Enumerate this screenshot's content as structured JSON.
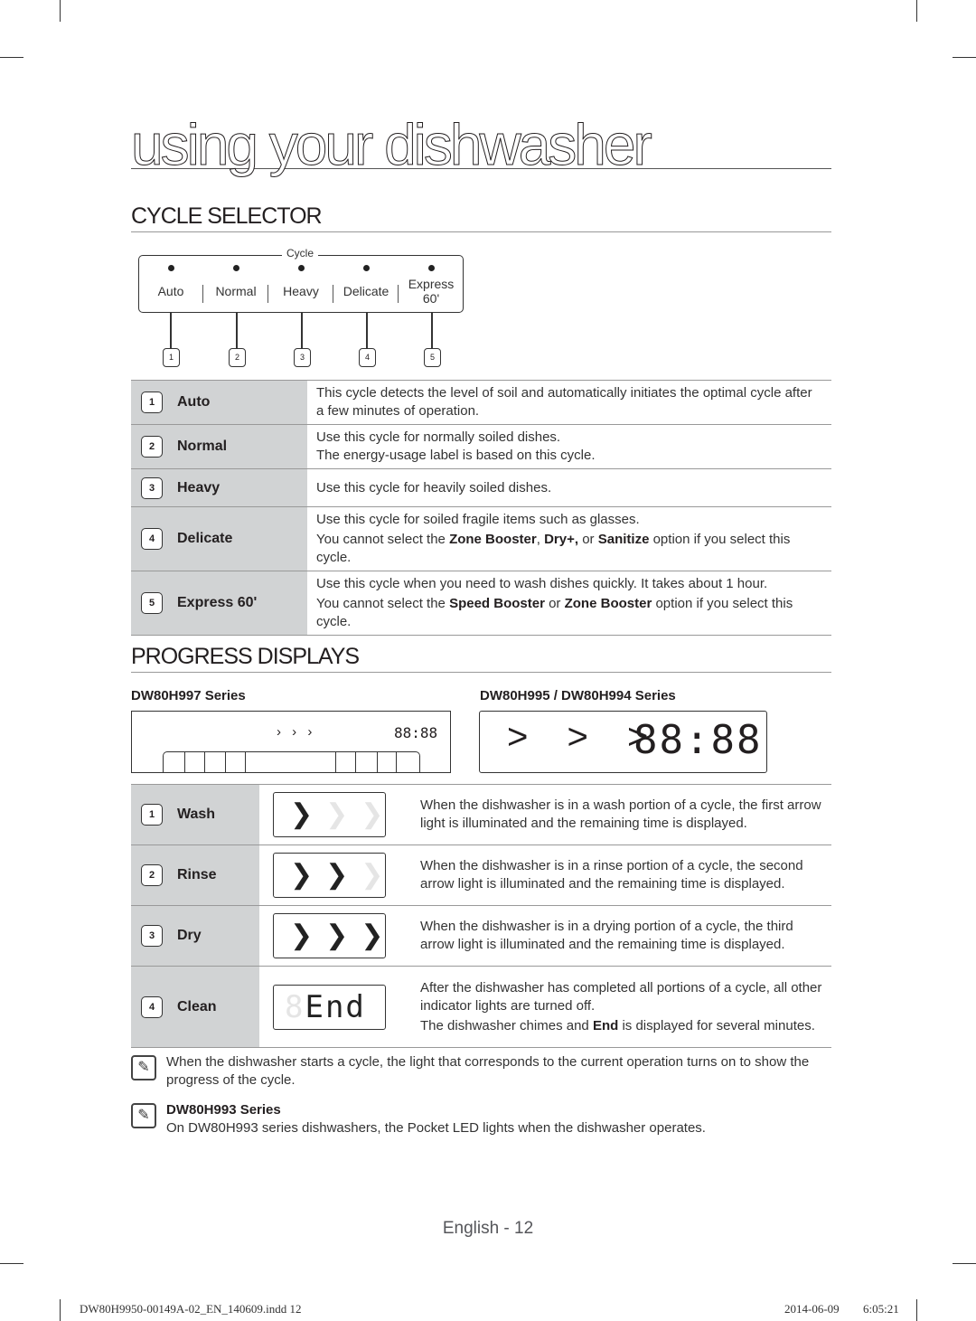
{
  "page_title": "using your dishwasher",
  "cycle_selector": {
    "heading": "CYCLE SELECTOR",
    "panel": {
      "legend": "Cycle",
      "buttons": [
        {
          "label": "Auto",
          "callout": "1"
        },
        {
          "label": "Normal",
          "callout": "2"
        },
        {
          "label": "Heavy",
          "callout": "3"
        },
        {
          "label": "Delicate",
          "callout": "4"
        },
        {
          "label": "Express 60'",
          "callout": "5"
        }
      ]
    },
    "rows": [
      {
        "num": "1",
        "name": "Auto",
        "lines": [
          "This cycle detects the level of soil and automatically initiates the optimal cycle after a few minutes of operation."
        ]
      },
      {
        "num": "2",
        "name": "Normal",
        "lines": [
          "Use this cycle for normally soiled dishes.",
          "The energy-usage label is based on this cycle."
        ]
      },
      {
        "num": "3",
        "name": "Heavy",
        "lines": [
          "Use this cycle for heavily soiled dishes."
        ]
      },
      {
        "num": "4",
        "name": "Delicate",
        "lines": [
          "Use this cycle for soiled fragile items such as glasses."
        ],
        "restriction": {
          "prefix": "You cannot select the ",
          "b1": "Zone Booster",
          "mid1": ", ",
          "b2": "Dry+,",
          "mid2": " or ",
          "b3": "Sanitize",
          "suffix": " option if you select this cycle."
        }
      },
      {
        "num": "5",
        "name": "Express 60'",
        "lines": [
          "Use this cycle when you need to wash dishes quickly. It takes about 1 hour."
        ],
        "restriction": {
          "prefix": "You cannot select the ",
          "b1": "Speed Booster",
          "mid1": " or ",
          "b2": "Zone Booster",
          "suffix": " option if you select this cycle."
        }
      }
    ]
  },
  "progress_displays": {
    "heading": "PROGRESS DISPLAYS",
    "series_a": {
      "label": "DW80H997 Series",
      "arrows": "› › ›",
      "clock": "88:88"
    },
    "series_b": {
      "label": "DW80H995 / DW80H994 Series",
      "arrows": "> > >",
      "clock": "88:88"
    },
    "rows": [
      {
        "num": "1",
        "name": "Wash",
        "arrows_lit": 1,
        "text": "When the dishwasher is in a wash portion of a cycle, the first arrow light is illuminated and the remaining time is displayed."
      },
      {
        "num": "2",
        "name": "Rinse",
        "arrows_lit": 2,
        "text": "When the dishwasher is in a rinse portion of a cycle, the second arrow light is illuminated and the remaining time is displayed."
      },
      {
        "num": "3",
        "name": "Dry",
        "arrows_lit": 3,
        "text": "When the dishwasher is in a drying portion of a cycle, the third arrow light is illuminated and the remaining time is displayed."
      },
      {
        "num": "4",
        "name": "Clean",
        "display": "End",
        "text": "After the dishwasher has completed all portions of a cycle, all other indicator lights are turned off.",
        "text2_prefix": "The dishwasher chimes and ",
        "text2_bold": "End",
        "text2_suffix": " is displayed for several minutes."
      }
    ],
    "arrow_glyph": "❯"
  },
  "notes": [
    {
      "icon": "note-icon",
      "title": "",
      "text": "When the dishwasher starts a cycle, the light that corresponds to the current operation turns on to show the progress of the cycle."
    },
    {
      "icon": "note-icon",
      "title": "DW80H993 Series",
      "text": "On DW80H993 series dishwashers, the Pocket LED lights when the dishwasher operates."
    }
  ],
  "footer": {
    "page_label": "English - 12",
    "slug_file": "DW80H9950-00149A-02_EN_140609.indd   12",
    "slug_date": "2014-06-09",
    "slug_time": "6:05:21"
  }
}
